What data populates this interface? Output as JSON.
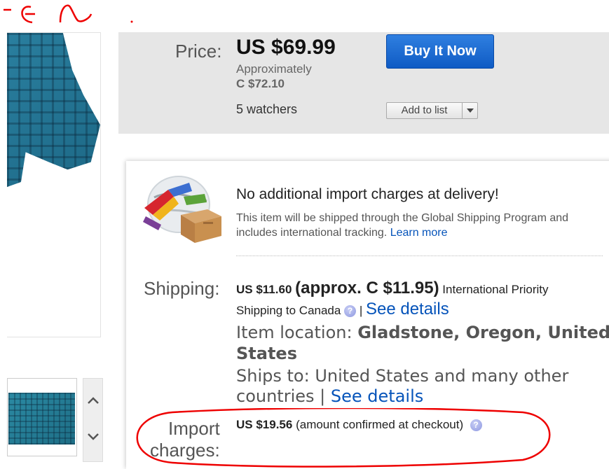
{
  "price": {
    "label": "Price:",
    "value": "US $69.99",
    "approx_label": "Approximately",
    "approx_value": "C $72.10",
    "watchers": "5 watchers"
  },
  "buttons": {
    "buy_now": "Buy It Now",
    "add_to_list": "Add to list"
  },
  "gsp": {
    "title": "No additional import charges at delivery!",
    "description": "This item will be shipped through the Global Shipping Program and includes international tracking.",
    "learn_more": "Learn more"
  },
  "shipping": {
    "label": "Shipping:",
    "cost": "US $11.60",
    "approx": "(approx. C $11.95)",
    "service": "International Priority",
    "destination": "Shipping to Canada",
    "separator": "|",
    "see_details": "See details",
    "location_label": "Item location:",
    "location_value": "Gladstone, Oregon, United States",
    "ships_to_label": "Ships to:",
    "ships_to_value": "United States and many other countries",
    "ships_to_separator": "|",
    "ships_to_see_details": "See details"
  },
  "import": {
    "label_line1": "Import",
    "label_line2": "charges:",
    "value": "US $19.56",
    "note": "(amount confirmed at checkout)"
  },
  "icons": {
    "help": "help-icon",
    "scroll_up": "chevron-up-icon",
    "scroll_down": "chevron-down-icon",
    "dropdown": "caret-down-icon"
  },
  "colors": {
    "buy_button": "#0f5bc4",
    "link": "#0654ba",
    "annotation": "#e00000",
    "panel": "#e6e6e6"
  }
}
